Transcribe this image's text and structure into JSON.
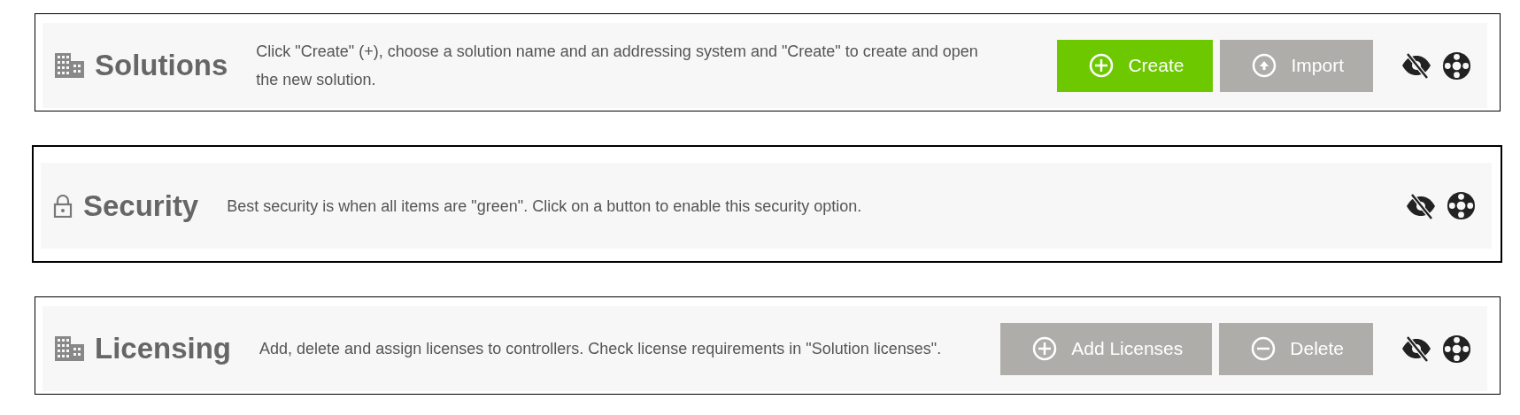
{
  "panels": [
    {
      "title": "Solutions",
      "kind": "building",
      "description": "Click \"Create\" (+), choose a solution name and an addressing system and \"Create\" to create and open the new solution.",
      "buttons": [
        {
          "label": "Create",
          "kind": "plus",
          "color": "#6dc800"
        },
        {
          "label": "Import",
          "kind": "up",
          "color": "#afadaa"
        }
      ]
    },
    {
      "title": "Security",
      "kind": "lock",
      "description": "Best security is when all items are \"green\". Click on a button to enable this security option."
    },
    {
      "title": "Licensing",
      "kind": "building",
      "description": "Add, delete and assign licenses to controllers. Check license requirements in \"Solution licenses\".",
      "buttons": [
        {
          "label": "Add Licenses",
          "kind": "plus",
          "color": "#afadaa"
        },
        {
          "label": "Delete",
          "kind": "minus",
          "color": "#afadaa"
        }
      ]
    }
  ]
}
